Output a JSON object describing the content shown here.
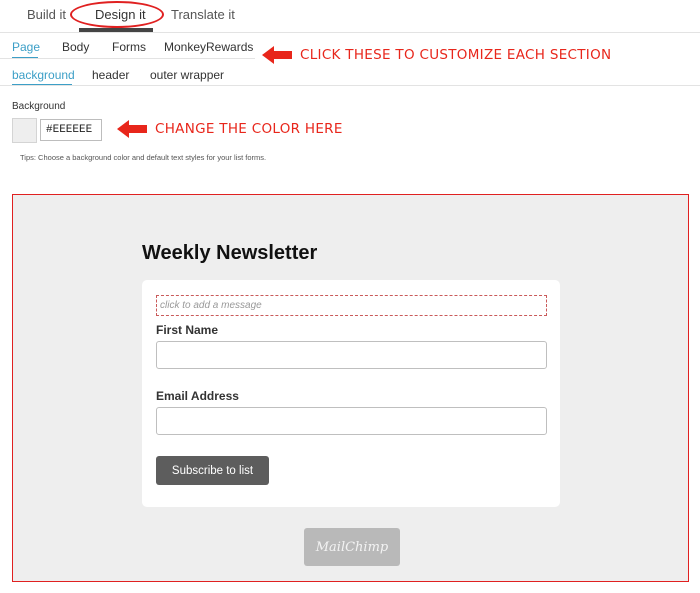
{
  "top_tabs": {
    "build": "Build it",
    "design": "Design it",
    "translate": "Translate it"
  },
  "section_tabs": [
    "Page",
    "Body",
    "Forms",
    "MonkeyRewards"
  ],
  "element_tabs": [
    "background",
    "header",
    "outer wrapper"
  ],
  "annotations": {
    "sections": "CLICK THESE TO CUSTOMIZE EACH SECTION",
    "color": "CHANGE THE COLOR HERE"
  },
  "background": {
    "label": "Background",
    "value": "#EEEEEE",
    "tips": "Tips: Choose a background color and default text styles for your list forms."
  },
  "preview": {
    "title": "Weekly Newsletter",
    "message_placeholder": "click to add a message",
    "first_name_label": "First Name",
    "email_label": "Email Address",
    "submit_label": "Subscribe to list",
    "badge": "MailChimp"
  },
  "colors": {
    "accent": "#3c9fc7",
    "annotation": "#e8261b",
    "preview_bg": "#eeeeee"
  }
}
